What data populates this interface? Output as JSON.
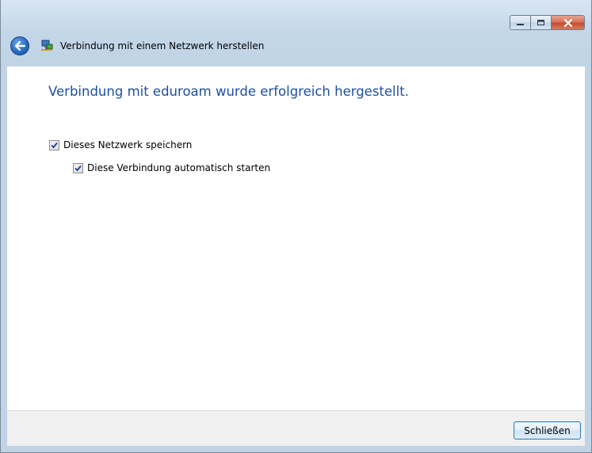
{
  "window": {
    "title": "Verbindung mit einem Netzwerk herstellen",
    "caption_buttons": [
      "minimize-icon",
      "maximize-icon",
      "close-icon"
    ]
  },
  "nav": {
    "back_icon": "back-arrow-icon",
    "app_icon": "network-connection-icon"
  },
  "content": {
    "heading": "Verbindung mit eduroam wurde erfolgreich hergestellt.",
    "options": [
      {
        "label": "Dieses Netzwerk speichern",
        "checked": true
      },
      {
        "label": "Diese Verbindung automatisch starten",
        "checked": true
      }
    ]
  },
  "footer": {
    "close_label": "Schließen"
  },
  "colors": {
    "heading": "#1e4f9e",
    "footer_bg": "#f0f0f0",
    "title_bar": "#c4d7e9"
  }
}
